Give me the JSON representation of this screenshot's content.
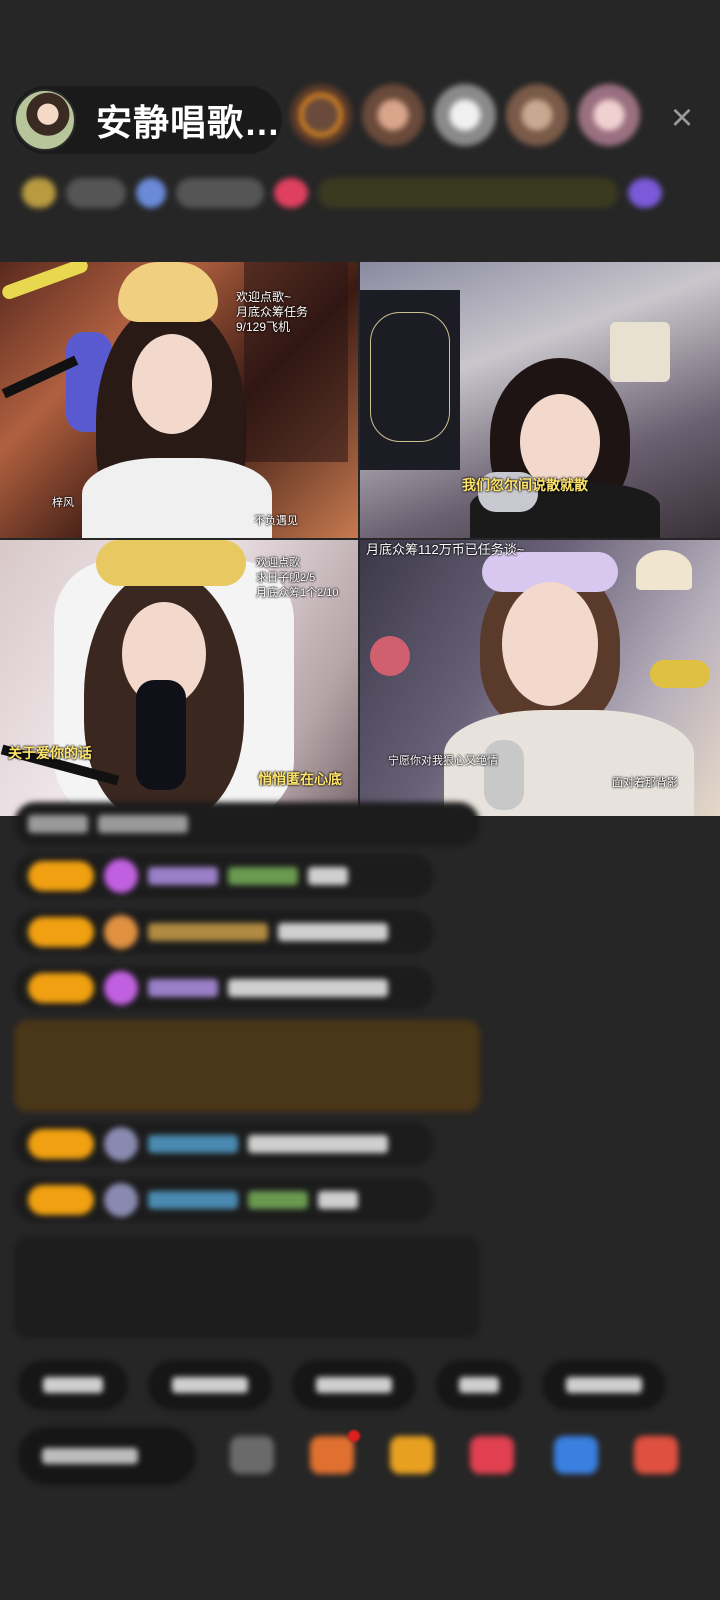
{
  "header": {
    "host_name": "安静唱歌…",
    "close_icon": "close-icon"
  },
  "tiles": {
    "tile1": {
      "welcome_lines": [
        "欢迎点歌~",
        "月底众筹任务",
        "9/129飞机"
      ],
      "bottom_left": "梓风",
      "bottom_right": "不负遇见"
    },
    "tile2": {
      "caption": "我们忽尔间说散就散"
    },
    "tile3": {
      "welcome_lines": [
        "欢迎点歌",
        "求日子舰2/5",
        "月底众筹1个2/10"
      ],
      "caption_left": "关于爱你的话",
      "caption_right": "悄悄匿在心底"
    },
    "tile4": {
      "top_text": "月底众筹112万币已任务谈~",
      "caption": "宁愿你对我狠心又绝情",
      "bottom_right": "面对着那背影"
    }
  },
  "colors": {
    "background": "#262626",
    "level_badge": "#f0a010",
    "highlight_caption": "#ffe46a"
  }
}
